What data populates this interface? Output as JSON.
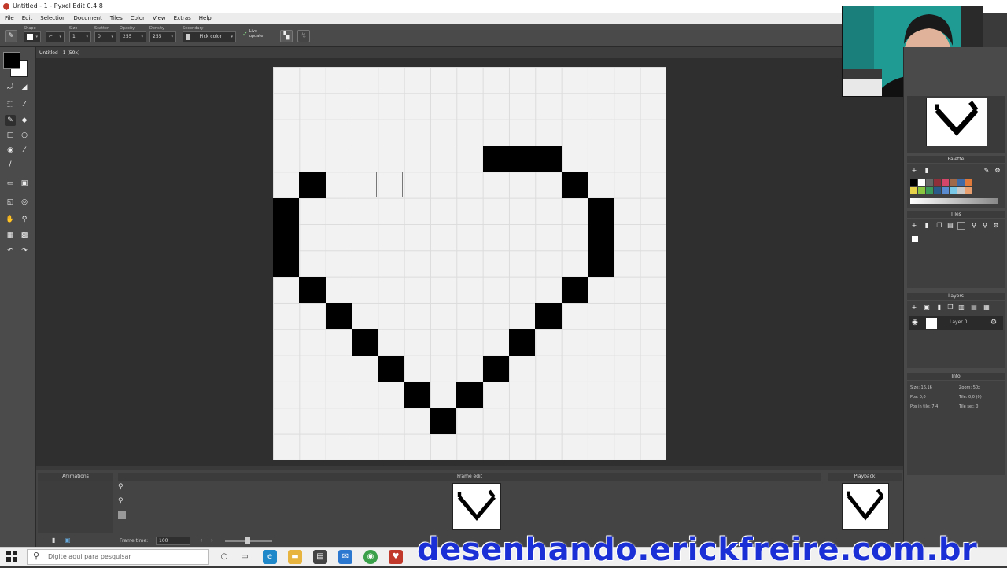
{
  "window": {
    "title": "Untitled - 1 - Pyxel Edit 0.4.8"
  },
  "menu": {
    "items": [
      "File",
      "Edit",
      "Selection",
      "Document",
      "Tiles",
      "Color",
      "View",
      "Extras",
      "Help"
    ]
  },
  "toolbar": {
    "shape_label": "Shape",
    "size_label": "Size",
    "size_value": "1",
    "scatter_label": "Scatter",
    "scatter_value": "0",
    "opacity_label": "Opacity",
    "opacity_value": "255",
    "density_label": "Density",
    "density_value": "255",
    "secondary_label": "Secondary",
    "secondary_value": "Pick color",
    "live_update_label": "Live update"
  },
  "document": {
    "tab_label": "Untitled - 1 (50x)"
  },
  "panels": {
    "palette_title": "Palette",
    "tiles_title": "Tiles",
    "layers_title": "Layers",
    "layer_name": "Layer 0",
    "info_title": "Info",
    "info": {
      "size": "Size: 16,16",
      "zoom": "Zoom: 50x",
      "pos": "Pos: 0,0",
      "tile": "Tile: 0,0 (0)",
      "pos_in_tile": "Pos in tile: 7,4",
      "tile_set": "Tile set: 0"
    }
  },
  "bottom": {
    "animations_title": "Animations",
    "frame_edit_title": "Frame edit",
    "playback_title": "Playback",
    "frame_time_label": "Frame time:",
    "frame_time_value": "100"
  },
  "taskbar": {
    "search_placeholder": "Digite aqui para pesquisar"
  },
  "watermark": "desenhando.erickfreire.com.br",
  "pixel_art": {
    "grid": 15,
    "filled_cells": [
      [
        8,
        3
      ],
      [
        9,
        3
      ],
      [
        10,
        3
      ],
      [
        1,
        4
      ],
      [
        11,
        4
      ],
      [
        0,
        5
      ],
      [
        12,
        5
      ],
      [
        0,
        6
      ],
      [
        12,
        6
      ],
      [
        0,
        7
      ],
      [
        12,
        7
      ],
      [
        1,
        8
      ],
      [
        11,
        8
      ],
      [
        2,
        9
      ],
      [
        10,
        9
      ],
      [
        3,
        10
      ],
      [
        9,
        10
      ],
      [
        4,
        11
      ],
      [
        8,
        11
      ],
      [
        5,
        12
      ],
      [
        7,
        12
      ],
      [
        6,
        13
      ]
    ]
  },
  "colors": {
    "primary": "#000000",
    "secondary": "#ffffff",
    "watermark": "#1a2fd6"
  }
}
